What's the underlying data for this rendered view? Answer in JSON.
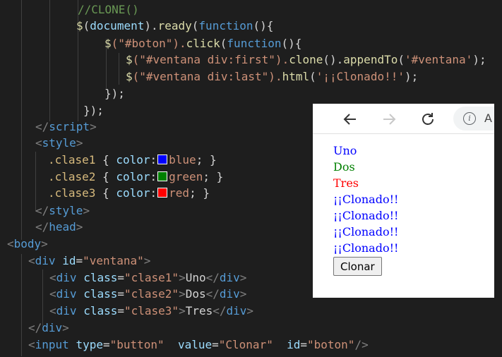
{
  "code": {
    "comment": "//CLONE()",
    "l2": [
      "$",
      "(",
      "document",
      ").",
      "ready",
      "(",
      "function",
      "(){"
    ],
    "l3": [
      "$",
      "(\"",
      "#boton",
      "\").",
      "click",
      "(",
      "function",
      "(){"
    ],
    "l4": [
      "$",
      "(\"",
      "#ventana div:first",
      "\").",
      "clone",
      "().",
      "appendTo",
      "(",
      "'#ventana'",
      ");"
    ],
    "l5": [
      "$",
      "(\"",
      "#ventana div:last",
      "\").",
      "html",
      "(",
      "'¡¡Clonado!!'",
      ");"
    ],
    "l6": "});",
    "l7": "});",
    "script_close": [
      "</",
      "script",
      ">"
    ],
    "style_open": [
      "<",
      "style",
      ">"
    ],
    "css": [
      {
        "selector": ".clase1",
        "open": " { ",
        "prop": "color",
        "colon": ":",
        "value": "blue",
        "close": "; }",
        "swatch": "#0000ff"
      },
      {
        "selector": ".clase2",
        "open": " { ",
        "prop": "color",
        "colon": ":",
        "value": "green",
        "close": "; }",
        "swatch": "#008000"
      },
      {
        "selector": ".clase3",
        "open": " { ",
        "prop": "color",
        "colon": ":",
        "value": "red",
        "close": "; }",
        "swatch": "#ff0000"
      }
    ],
    "style_close": [
      "</",
      "style",
      ">"
    ],
    "head_close": [
      "</",
      "head",
      ">"
    ],
    "body_open": [
      "<",
      "body",
      ">"
    ],
    "div_open": [
      "<",
      "div",
      "id",
      "=",
      "\"ventana\"",
      ">"
    ],
    "inner_divs": [
      {
        "lt": "<",
        "tag": "div",
        "attr": "class",
        "eq": "=",
        "val": "\"clase1\"",
        "gt": ">",
        "text": "Uno",
        "close_lt": "</",
        "close_tag": "div",
        "close_gt": ">"
      },
      {
        "lt": "<",
        "tag": "div",
        "attr": "class",
        "eq": "=",
        "val": "\"clase2\"",
        "gt": ">",
        "text": "Dos",
        "close_lt": "</",
        "close_tag": "div",
        "close_gt": ">"
      },
      {
        "lt": "<",
        "tag": "div",
        "attr": "class",
        "eq": "=",
        "val": "\"clase3\"",
        "gt": ">",
        "text": "Tres",
        "close_lt": "</",
        "close_tag": "div",
        "close_gt": ">"
      }
    ],
    "div_close": [
      "</",
      "div",
      ">"
    ],
    "input_line": [
      "<",
      "input",
      "type",
      "=",
      "\"button\"",
      "value",
      "=",
      "\"Clonar\"",
      "id",
      "=",
      "\"boton\"",
      "/>"
    ]
  },
  "browser": {
    "back_icon": "arrow-left-icon",
    "forward_icon": "arrow-right-icon",
    "reload_icon": "reload-icon",
    "info_glyph": "i",
    "address_partial": "A",
    "items": [
      {
        "text": "Uno",
        "color": "#0000ff"
      },
      {
        "text": "Dos",
        "color": "#008000"
      },
      {
        "text": "Tres",
        "color": "#ff0000"
      },
      {
        "text": "¡¡Clonado!!",
        "color": "#0000ff"
      },
      {
        "text": "¡¡Clonado!!",
        "color": "#0000ff"
      },
      {
        "text": "¡¡Clonado!!",
        "color": "#0000ff"
      },
      {
        "text": "¡¡Clonado!!",
        "color": "#0000ff"
      }
    ],
    "button_label": "Clonar"
  }
}
